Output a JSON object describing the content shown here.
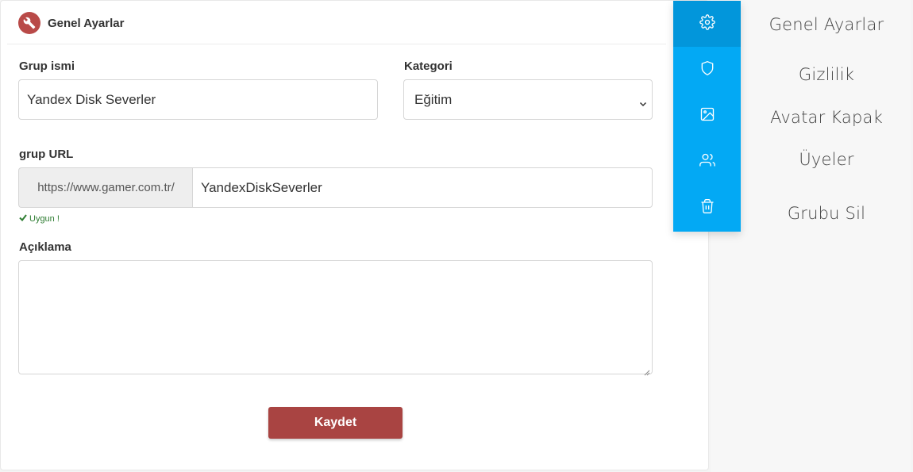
{
  "header": {
    "title": "Genel Ayarlar",
    "icon": "wrench-icon",
    "icon_color": "#b94a48"
  },
  "form": {
    "group_name": {
      "label": "Grup ismi",
      "value": "Yandex Disk Severler"
    },
    "category": {
      "label": "Kategori",
      "selected": "Eğitim"
    },
    "group_url": {
      "label": "grup URL",
      "prefix": "https://www.gamer.com.tr/",
      "value": "YandexDiskSeverler",
      "validation": "Uygun !"
    },
    "description": {
      "label": "Açıklama",
      "value": ""
    },
    "save_label": "Kaydet",
    "save_color": "#a94442"
  },
  "sidebar": {
    "accent": "#03a9f4",
    "items": [
      {
        "label": "Genel Ayarlar",
        "icon": "gear-icon",
        "active": true
      },
      {
        "label": "Gizlilik",
        "icon": "shield-icon",
        "active": false
      },
      {
        "label": "Avatar Kapak",
        "icon": "image-icon",
        "active": false
      },
      {
        "label": "Üyeler",
        "icon": "users-icon",
        "active": false
      },
      {
        "label": "Grubu Sil",
        "icon": "trash-icon",
        "active": false
      }
    ]
  }
}
